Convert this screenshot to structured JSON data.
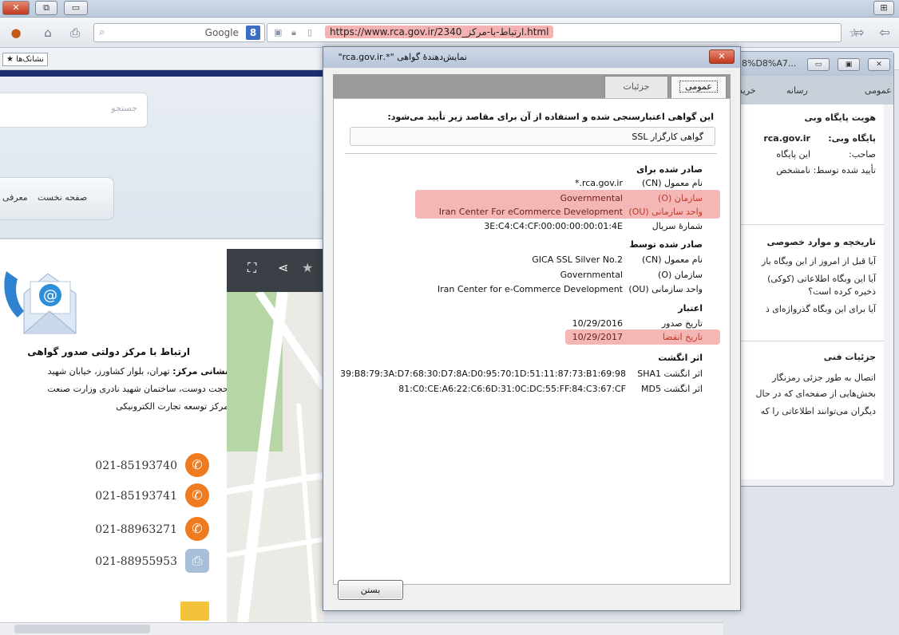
{
  "window": {
    "close_label": "✕",
    "restore_label": "⧉",
    "min_label": "▭",
    "grid_label": "⊞"
  },
  "toolbar": {
    "search_engine": "Google",
    "search_badge": "8",
    "url": "https://www.rca.gov.ir/2340_ارتباط-با-مرکز.html"
  },
  "bookmarks": {
    "label": "نشانک‌ها"
  },
  "page": {
    "search_placeholder": "جستجو",
    "menu": [
      "صفحه نخست",
      "معرفی"
    ],
    "contact": {
      "title": "ارتباط با مرکز دولتی صدور گواهی",
      "address_label": "نشانی مرکز:",
      "address_line1": "تهران، بلوار کشاورز، خیابان شهید",
      "address_line2": "حجت دوست، ساختمان شهید نادری وزارت صنعت",
      "address_line3": "مرکز توسعه تجارت الکترونیکی",
      "phones": [
        "021-85193740",
        "021-85193741",
        "021-88963271",
        "021-88955953"
      ]
    }
  },
  "page_info": {
    "title": "8%D8%A7...",
    "tabs": [
      "عمومی",
      "رسانه",
      "خرید"
    ],
    "identity_title": "هویت پایگاه وبی",
    "site_label": "پایگاه وبی:",
    "site_value": "rca.gov.ir",
    "owner_label": "صاحب:",
    "owner_value": "این پایگاه",
    "verified_label": "تأیید شده توسط:",
    "verified_value": "نامشخص",
    "privacy_title": "تاریخچه و موارد خصوصی",
    "privacy_q1": "آیا قبل از امروز از این وبگاه باز",
    "privacy_q2": "آیا این وبگاه اطلاعاتی (کوکی)",
    "privacy_q2b": "ذخیره کرده است؟",
    "privacy_q3": "آیا برای این وبگاه گذرواژه‌ای ذ",
    "tech_title": "جزئیات فنی",
    "tech_l1": "اتصال به طور جزئی رمزنگار",
    "tech_l2": "بخش‌هایی از صفحه‌ای که در حال",
    "tech_l3": "دیگران می‌توانند اطلاعاتی را که"
  },
  "dialog": {
    "title": "نمایش‌دهندهٔ گواهی \"*.rca.gov.ir\"",
    "close_icon": "✕",
    "tabs": {
      "general": "عمومی",
      "details": "جزئیات"
    },
    "intro": "این گواهی اعتبارسنجی شده و استفاده از آن برای مقاصد زیر تأیید می‌شود:",
    "purpose": "گواهی کارگزار SSL",
    "issued_to": {
      "heading": "صادر شده برای",
      "cn_label": "نام معمول (CN)",
      "cn_value": "*.rca.gov.ir",
      "o_label": "سازمان (O)",
      "o_value": "Governmental",
      "ou_label": "واحد سازمانی (OU)",
      "ou_value": "Iran Center For eCommerce Development",
      "serial_label": "شمارهٔ سریال",
      "serial_value": "3E:C4:C4:CF:00:00:00:00:01:4E"
    },
    "issued_by": {
      "heading": "صادر شده توسط",
      "cn_label": "نام معمول (CN)",
      "cn_value": "GICA SSL Silver No.2",
      "o_label": "سازمان (O)",
      "o_value": "Governmental",
      "ou_label": "واحد سازمانی (OU)",
      "ou_value": "Iran Center for e-Commerce Development"
    },
    "validity": {
      "heading": "اعتبار",
      "issued_label": "تاریخ صدور",
      "issued_value": "10/29/2016",
      "expires_label": "تاریخ انقضا",
      "expires_value": "10/29/2017"
    },
    "fingerprints": {
      "heading": "اثر انگشت",
      "sha1_label": "اثر انگشت SHA1",
      "sha1_value": "39:B8:79:3A:D7:68:30:D7:8A:D0:95:70:1D:51:11:87:73:B1:69:98",
      "md5_label": "اثر انگشت MD5",
      "md5_value": "81:C0:CE:A6:22:C6:6D:31:0C:DC:55:FF:84:C3:67:CF"
    },
    "close_button": "بستن"
  },
  "colors": {
    "highlight": "#f5b7b5",
    "phone_icon": "#f07b1f",
    "brand_band": "#1b2f6e"
  }
}
